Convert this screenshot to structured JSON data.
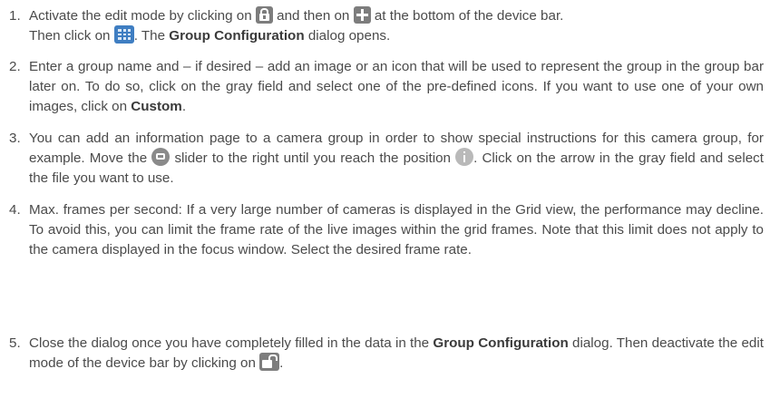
{
  "steps": [
    {
      "num": "1.",
      "line1": "Activate the edit mode by clicking on",
      "line1b": "and then on",
      "line1c": "at the bottom of the device bar.",
      "line2a": "Then click on",
      "line2b": ". The",
      "bold": "Group Configuration",
      "line2c": "dialog opens.",
      "icons": [
        "lock-icon",
        "plus-icon",
        "grid-icon"
      ]
    },
    {
      "num": "2.",
      "text": "Enter a group name and – if desired – add an image or an icon that will be used to represent the group in the group bar later on. To do so, click on the gray field and select one of the pre-defined icons. If you want to use one of your own images, click on",
      "bold": "Custom",
      "end": "."
    },
    {
      "num": "3.",
      "text1": "You can add an information page to a camera group in order to show special instructions for this camera group, for example. Move the",
      "text2": "slider to the right until you reach the position",
      "text3": ". Click on the arrow in the gray field and select the file you want to use.",
      "icons": [
        "slider-icon",
        "info-icon"
      ]
    },
    {
      "num": "4.",
      "text": "Max. frames per second: If a very large number of cameras is displayed in the Grid view, the performance may decline. To avoid this, you can limit the frame rate of the live images within the grid frames. Note that this limit does not apply to the camera displayed in the focus window. Select the desired frame rate."
    },
    {
      "num": "5.",
      "text1": "Close the dialog once you have completely filled in the data in the",
      "bold": "Group Configuration",
      "text2": "dialog. Then deactivate the edit mode of the device bar by clicking on",
      "end": ".",
      "icons": [
        "unlock-icon"
      ]
    }
  ]
}
